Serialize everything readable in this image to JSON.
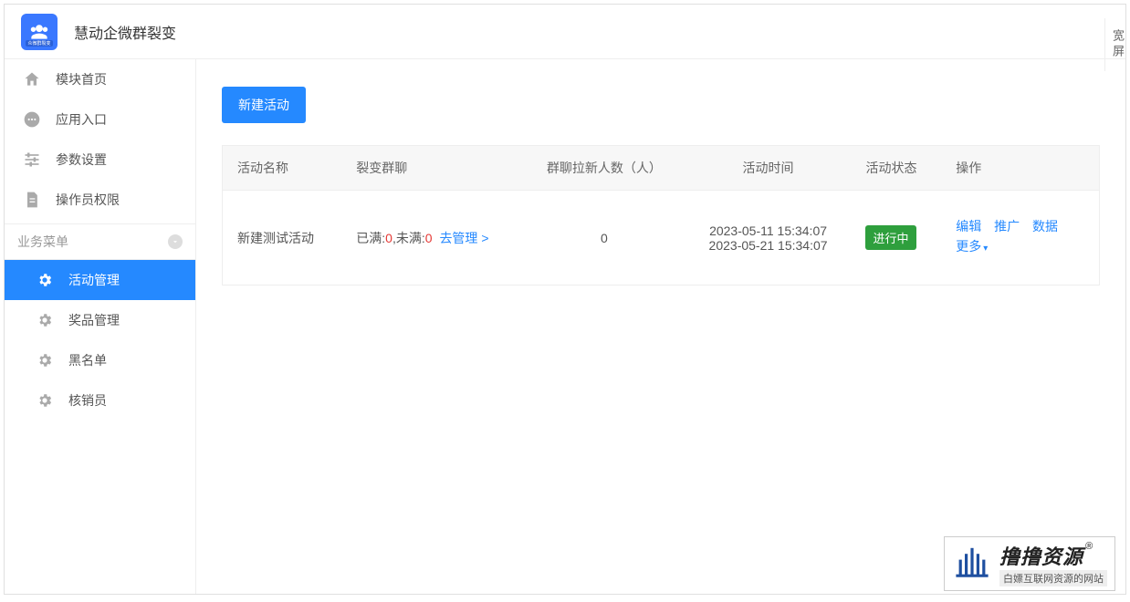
{
  "header": {
    "title": "慧动企微群裂变"
  },
  "nav": {
    "items": [
      {
        "label": "模块首页",
        "icon": "home"
      },
      {
        "label": "应用入口",
        "icon": "chat"
      },
      {
        "label": "参数设置",
        "icon": "sliders"
      },
      {
        "label": "操作员权限",
        "icon": "doc"
      }
    ],
    "sectionTitle": "业务菜单",
    "subs": [
      {
        "label": "活动管理",
        "active": true
      },
      {
        "label": "奖品管理",
        "active": false
      },
      {
        "label": "黑名单",
        "active": false
      },
      {
        "label": "核销员",
        "active": false
      }
    ]
  },
  "main": {
    "newBtn": "新建活动",
    "columns": [
      "活动名称",
      "裂变群聊",
      "群聊拉新人数（人）",
      "活动时间",
      "活动状态",
      "操作"
    ],
    "row": {
      "name": "新建测试活动",
      "fullLabel": "已满:",
      "fullVal": "0",
      "notFullLabel": ",未满:",
      "notFullVal": "0",
      "manageLink": "去管理 >",
      "newCount": "0",
      "time1": "2023-05-11 15:34:07",
      "time2": "2023-05-21 15:34:07",
      "status": "进行中",
      "ops": {
        "edit": "编辑",
        "promote": "推广",
        "data": "数据",
        "more": "更多"
      }
    }
  },
  "rightTab": "宽屏",
  "watermark": {
    "main": "撸撸资源",
    "reg": "®",
    "sub": "白嫖互联网资源的网站"
  }
}
